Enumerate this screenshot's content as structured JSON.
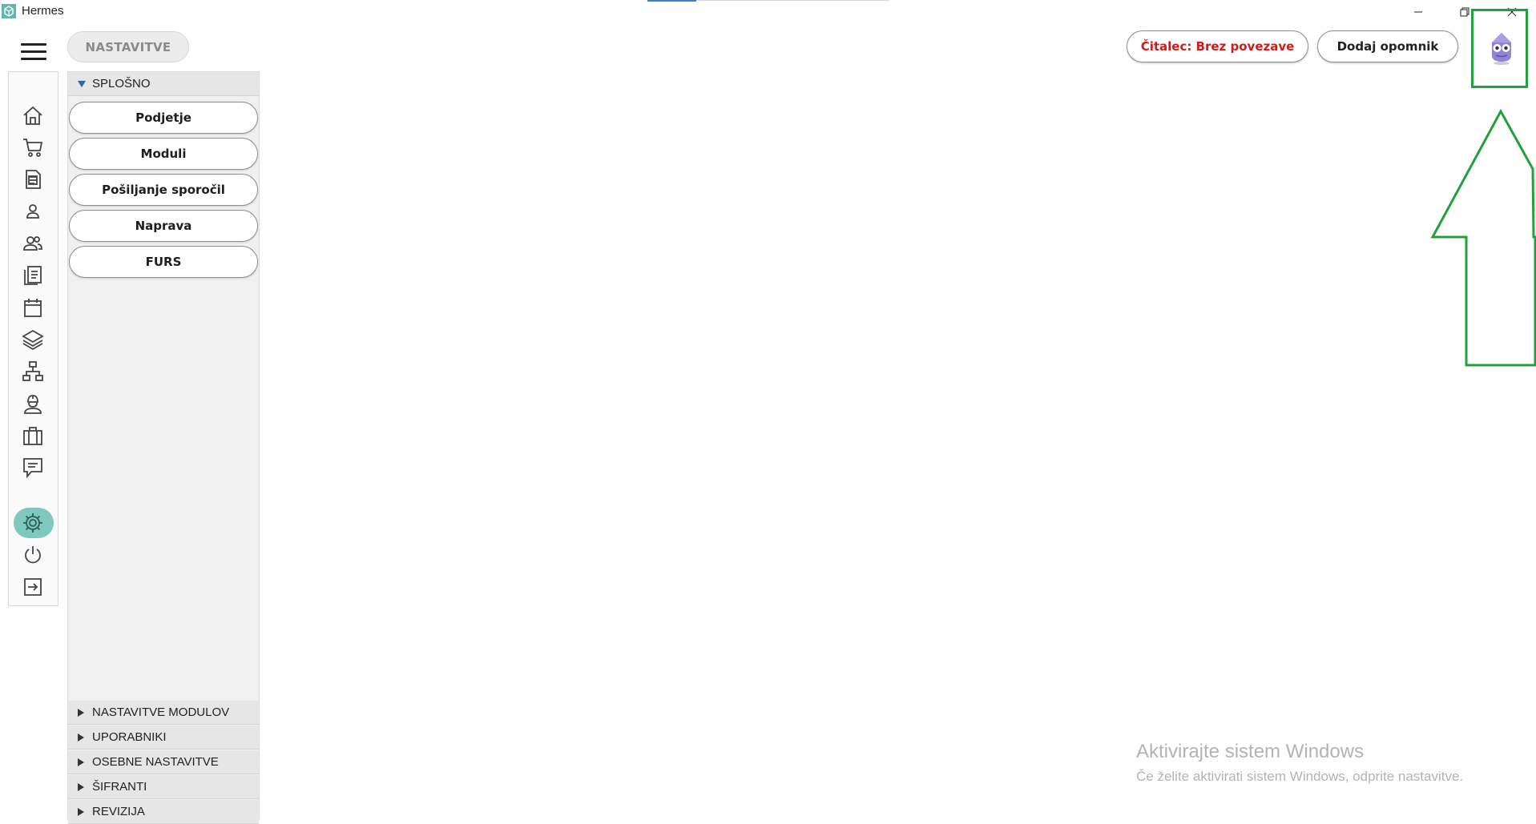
{
  "window": {
    "title": "Hermes"
  },
  "toolbar": {
    "tab_label": "NASTAVITVE",
    "reader_label": "Čitalec: Brez povezave",
    "reminder_label": "Dodaj opomnik"
  },
  "colors": {
    "accent_teal": "#7fc8be",
    "reader_red": "#d11a1a",
    "highlight_green": "#22a03f"
  },
  "sidebar": {
    "icons": [
      "home-icon",
      "cart-icon",
      "document-icon",
      "person-icon",
      "people-icon",
      "list-icon",
      "calendar-icon",
      "layers-icon",
      "network-icon",
      "worker-icon",
      "briefcase-icon",
      "message-icon",
      "gear-icon",
      "power-icon",
      "logout-icon"
    ],
    "active": "gear-icon"
  },
  "settings": {
    "general": {
      "label": "SPLOŠNO",
      "items": [
        "Podjetje",
        "Moduli",
        "Pošiljanje sporočil",
        "Naprava",
        "FURS"
      ]
    },
    "sections": [
      "NASTAVITVE MODULOV",
      "UPORABNIKI",
      "OSEBNE NASTAVITVE",
      "ŠIFRANTI",
      "REVIZIJA"
    ]
  },
  "watermark": {
    "title": "Aktivirajte sistem Windows",
    "subtitle": "Če želite aktivirati sistem Windows, odprite nastavitve."
  }
}
